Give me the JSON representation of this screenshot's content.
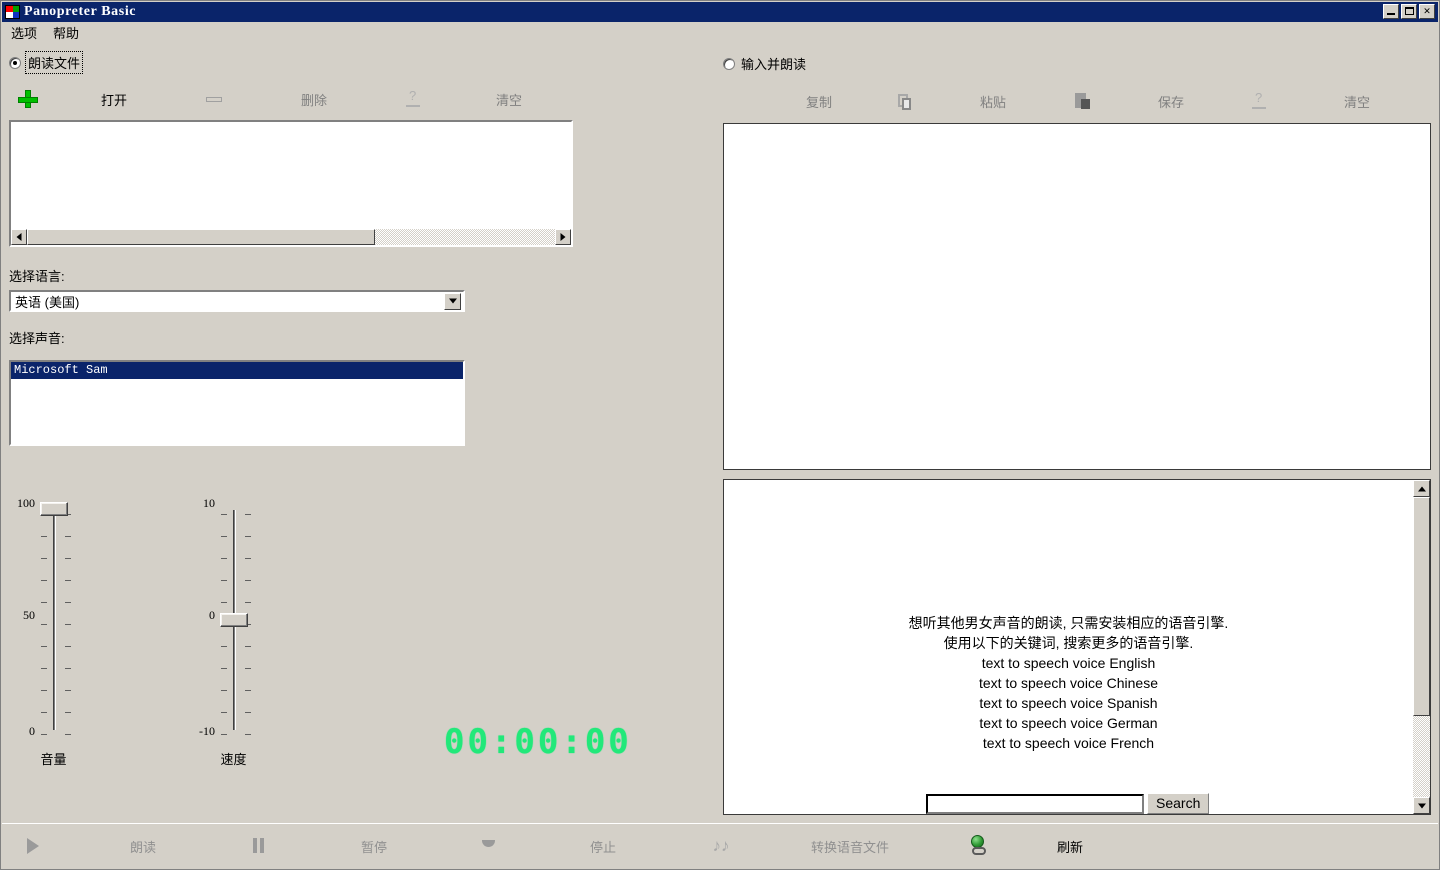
{
  "window": {
    "title": "Panopreter Basic",
    "controls": {
      "minimize": "_",
      "maximize": "□",
      "close": "✕"
    }
  },
  "menu": {
    "items": [
      {
        "label": "选项"
      },
      {
        "label": "帮助"
      }
    ]
  },
  "left_panel": {
    "mode_radio": {
      "label": "朗读文件",
      "selected": true
    },
    "toolbar": [
      {
        "name": "add",
        "icon": "plus-icon",
        "label": "打开",
        "enabled": true
      },
      {
        "name": "remove",
        "icon": "minus-icon",
        "label": "删除",
        "enabled": false
      },
      {
        "name": "clear",
        "icon": "eraser-icon",
        "label": "清空",
        "enabled": false
      }
    ],
    "file_list": {
      "items": []
    },
    "language_label": "选择语言:",
    "language_value": "英语 (美国)",
    "voice_label": "选择声音:",
    "voices": [
      {
        "name": "Microsoft Sam",
        "selected": true
      }
    ]
  },
  "sliders": {
    "volume": {
      "caption": "音量",
      "min": 0,
      "max": 100,
      "value": 100,
      "tick_labels": [
        "100",
        "50",
        "0"
      ]
    },
    "speed": {
      "caption": "速度",
      "min": -10,
      "max": 10,
      "value": 0,
      "tick_labels": [
        "10",
        "0",
        "-10"
      ]
    }
  },
  "timer": {
    "value": "00:00:00"
  },
  "right_panel": {
    "mode_radio": {
      "label": "输入并朗读",
      "selected": false
    },
    "toolbar": [
      {
        "name": "copy",
        "icon": "copy-icon",
        "label": "复制",
        "enabled": false
      },
      {
        "name": "paste",
        "icon": "paste-icon",
        "label": "粘贴",
        "enabled": false
      },
      {
        "name": "save",
        "icon": "save-icon",
        "label": "保存",
        "enabled": false
      },
      {
        "name": "clear",
        "icon": "eraser-icon",
        "label": "清空",
        "enabled": false
      }
    ],
    "editor_text": ""
  },
  "help_panel": {
    "lines": [
      "想听其他男女声音的朗读, 只需安装相应的语音引擎.",
      "使用以下的关键词, 搜索更多的语音引擎.",
      "text to speech voice English",
      "text to speech voice Chinese",
      "text to speech voice Spanish",
      "text to speech voice German",
      "text to speech voice French"
    ],
    "search_value": "",
    "search_button": "Search"
  },
  "bottom_bar": [
    {
      "name": "speak",
      "icon": "play-icon",
      "label": "朗读",
      "enabled": false
    },
    {
      "name": "pause",
      "icon": "pause-icon",
      "label": "暂停",
      "enabled": false
    },
    {
      "name": "stop",
      "icon": "stop-icon",
      "label": "停止",
      "enabled": false
    },
    {
      "name": "convert",
      "icon": "music-notes-icon",
      "label": "转换语音文件",
      "enabled": false
    },
    {
      "name": "refresh",
      "icon": "globe-link-icon",
      "label": "刷新",
      "enabled": true
    }
  ],
  "colors": {
    "face": "#d4d0c8",
    "title_bar": "#0a246a",
    "selection": "#0a246a",
    "lcd_green": "#22e87a",
    "plus_green": "#00c000"
  }
}
